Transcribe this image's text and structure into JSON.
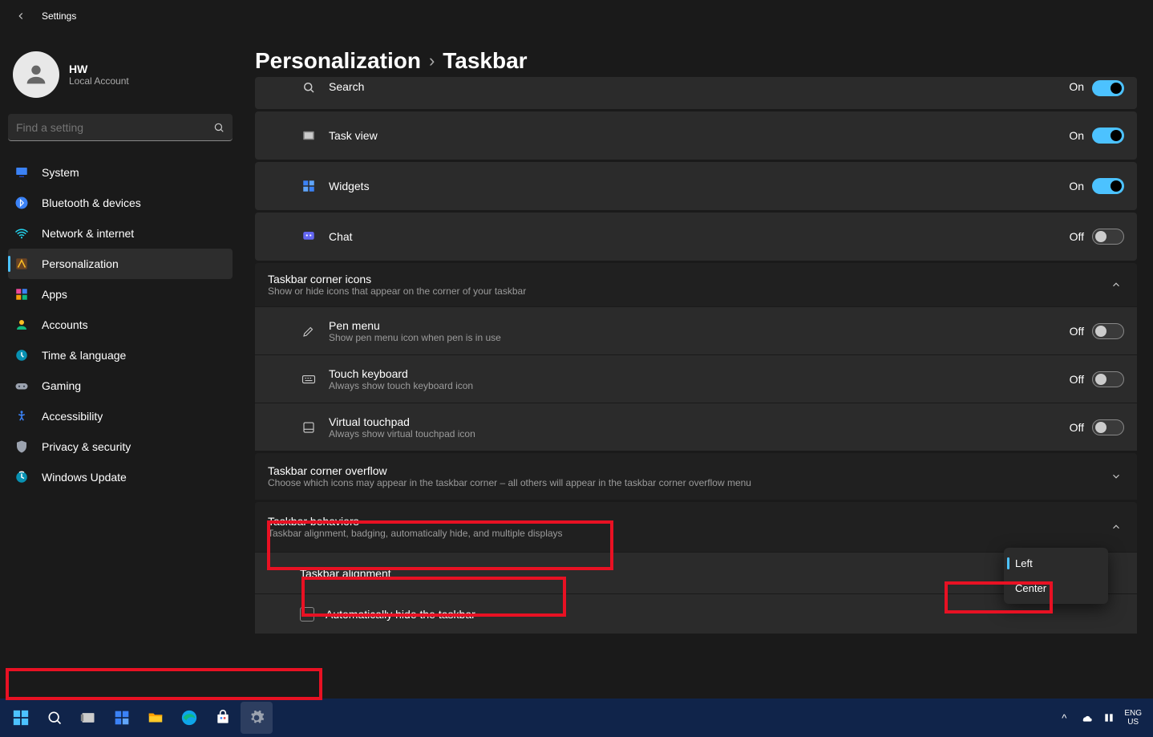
{
  "app_title": "Settings",
  "profile": {
    "name": "HW",
    "sub": "Local Account"
  },
  "search": {
    "placeholder": "Find a setting"
  },
  "sidebar": {
    "items": [
      {
        "label": "System",
        "icon": "system",
        "active": false
      },
      {
        "label": "Bluetooth & devices",
        "icon": "bluetooth",
        "active": false
      },
      {
        "label": "Network & internet",
        "icon": "network",
        "active": false
      },
      {
        "label": "Personalization",
        "icon": "personalization",
        "active": true
      },
      {
        "label": "Apps",
        "icon": "apps",
        "active": false
      },
      {
        "label": "Accounts",
        "icon": "accounts",
        "active": false
      },
      {
        "label": "Time & language",
        "icon": "time",
        "active": false
      },
      {
        "label": "Gaming",
        "icon": "gaming",
        "active": false
      },
      {
        "label": "Accessibility",
        "icon": "accessibility",
        "active": false
      },
      {
        "label": "Privacy & security",
        "icon": "privacy",
        "active": false
      },
      {
        "label": "Windows Update",
        "icon": "update",
        "active": false
      }
    ]
  },
  "breadcrumb": {
    "parent": "Personalization",
    "current": "Taskbar"
  },
  "taskbar_items": {
    "items": [
      {
        "title": "Search",
        "state": "On",
        "on": true,
        "icon": "search"
      },
      {
        "title": "Task view",
        "state": "On",
        "on": true,
        "icon": "taskview"
      },
      {
        "title": "Widgets",
        "state": "On",
        "on": true,
        "icon": "widgets"
      },
      {
        "title": "Chat",
        "state": "Off",
        "on": false,
        "icon": "chat"
      }
    ]
  },
  "corner_icons": {
    "title": "Taskbar corner icons",
    "sub": "Show or hide icons that appear on the corner of your taskbar",
    "items": [
      {
        "title": "Pen menu",
        "sub": "Show pen menu icon when pen is in use",
        "state": "Off",
        "on": false,
        "icon": "pen"
      },
      {
        "title": "Touch keyboard",
        "sub": "Always show touch keyboard icon",
        "state": "Off",
        "on": false,
        "icon": "keyboard"
      },
      {
        "title": "Virtual touchpad",
        "sub": "Always show virtual touchpad icon",
        "state": "Off",
        "on": false,
        "icon": "touchpad"
      }
    ]
  },
  "overflow": {
    "title": "Taskbar corner overflow",
    "sub": "Choose which icons may appear in the taskbar corner – all others will appear in the taskbar corner overflow menu"
  },
  "behaviors": {
    "title": "Taskbar behaviors",
    "sub": "Taskbar alignment, badging, automatically hide, and multiple displays",
    "alignment_label": "Taskbar alignment",
    "alignment_options": {
      "selected": "Left",
      "other": "Center"
    },
    "auto_hide": "Automatically hide the taskbar"
  },
  "taskbar": {
    "lang1": "ENG",
    "lang2": "US"
  }
}
